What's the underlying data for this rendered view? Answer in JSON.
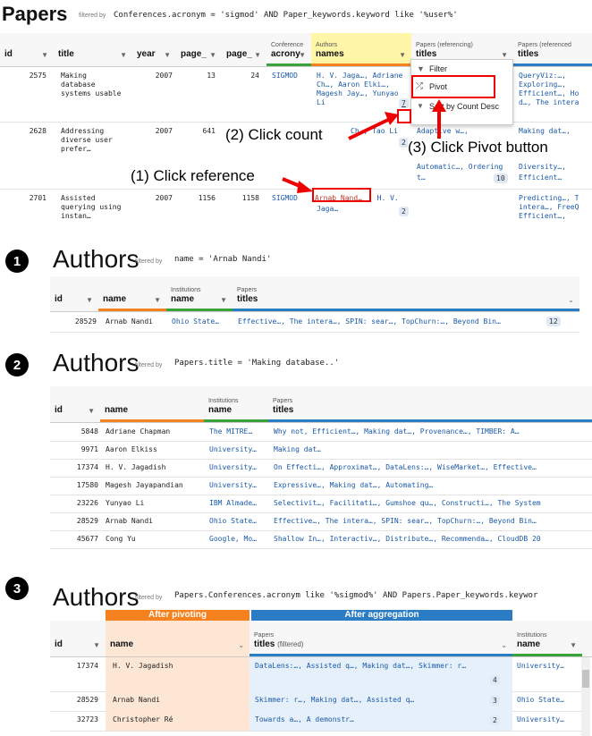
{
  "papers": {
    "title": "Papers",
    "filtered_by": "filtered by",
    "filter": "Conferences.acronym = 'sigmod' AND Paper_keywords.keyword like '%user%'",
    "columns": {
      "id": "id",
      "title": "title",
      "year": "year",
      "page1": "page_",
      "page2": "page_",
      "conf_sub": "Conference",
      "conf_main": "acrony",
      "authors_sub": "Authors",
      "authors_main": "names",
      "pref_sub": "Papers (referencing)",
      "pref_main": "titles",
      "pref2_sub": "Papers (referenced",
      "pref2_main": "titles"
    },
    "rows": [
      {
        "id": "2575",
        "title": [
          "Making",
          "database",
          "systems usable"
        ],
        "year": "2007",
        "p1": "13",
        "p2": "24",
        "conf": "SIGMOD",
        "authors": [
          "H. V. Jaga…, Adriane",
          "Ch…, Aaron Elki…,",
          "Magesh Jay…, Yunyao",
          "Li"
        ],
        "authors_count": "7",
        "ref2": [
          "QueryViz:…,",
          "Exploring…,",
          "Efficient…, Ho",
          "d…, The intera"
        ]
      },
      {
        "id": "2628",
        "title": [
          "Addressing",
          "diverse user",
          "prefer…"
        ],
        "year": "2007",
        "p1": "641",
        "p2": "",
        "conf": "",
        "authors": [
          "Ch…, Tao Li"
        ],
        "authors_count": "2",
        "refing": [
          "Adaptive w…,",
          "",
          "Automatic…, Ordering",
          "t…"
        ],
        "refing_count": "10",
        "ref2": [
          "Making dat…,",
          "",
          "Diversity…,",
          "Efficient…"
        ]
      },
      {
        "id": "2701",
        "title": [
          "Assisted",
          "querying using",
          "instan…"
        ],
        "year": "2007",
        "p1": "1156",
        "p2": "1158",
        "conf": "SIGMOD",
        "authors_link": "Arnab Nand…",
        "authors_rest": ", H. V.",
        "authors2": "Jaga…",
        "authors_count": "2",
        "ref2": [
          "Predicting…, T",
          "intera…, FreeQ",
          "Efficient…,"
        ]
      }
    ],
    "menu": {
      "filter": "Filter",
      "pivot": "Pivot",
      "sort": "Sort by Count Desc"
    }
  },
  "annotations": {
    "click_count": "(2) Click count",
    "click_pivot": "(3) Click Pivot button",
    "click_reference": "(1) Click reference"
  },
  "step1": {
    "badge": "1",
    "title": "Authors",
    "filtered_by": "filtered by",
    "filter": "name = 'Arnab Nandi'",
    "columns": {
      "id": "id",
      "name": "name",
      "inst_sub": "Institutions",
      "inst_main": "name",
      "papers_sub": "Papers",
      "papers_main": "titles"
    },
    "rows": [
      {
        "id": "28529",
        "name": "Arnab Nandi",
        "inst": "Ohio State…",
        "papers": "Effective…, The intera…, SPIN: sear…, TopChurn:…, Beyond Bin…",
        "count": "12"
      }
    ]
  },
  "step2": {
    "badge": "2",
    "title": "Authors",
    "filtered_by": "filtered by",
    "filter": "Papers.title = 'Making database..'",
    "columns": {
      "id": "id",
      "name": "name",
      "inst_sub": "Institutions",
      "inst_main": "name",
      "papers_sub": "Papers",
      "papers_main": "titles"
    },
    "rows": [
      {
        "id": "5848",
        "name": "Adriane Chapman",
        "inst": "The MITRE…",
        "papers": "Why not, Efficient…, Making dat…, Provenance…, TIMBER: A…"
      },
      {
        "id": "9971",
        "name": "Aaron Elkiss",
        "inst": "University…",
        "papers": "Making dat…"
      },
      {
        "id": "17374",
        "name": "H. V. Jagadish",
        "inst": "University…",
        "papers": "On Effecti…, Approximat…, DataLens:…, WiseMarket…, Effective…"
      },
      {
        "id": "17580",
        "name": "Magesh Jayapandian",
        "inst": "University…",
        "papers": "Expressive…, Making dat…, Automating…"
      },
      {
        "id": "23226",
        "name": "Yunyao Li",
        "inst": "IBM Almade…",
        "papers": "Selectivit…, Facilitati…, Gumshoe qu…, Constructi…, The System"
      },
      {
        "id": "28529",
        "name": "Arnab Nandi",
        "inst": "Ohio State…",
        "papers": "Effective…, The intera…, SPIN: sear…, TopChurn:…, Beyond Bin…"
      },
      {
        "id": "45677",
        "name": "Cong Yu",
        "inst": "Google, Mo…",
        "papers": "Shallow In…, Interactiv…, Distribute…, Recommenda…, CloudDB 20"
      }
    ]
  },
  "step3": {
    "badge": "3",
    "title": "Authors",
    "filtered_by": "filtered by",
    "filter": "Papers.Conferences.acronym like '%sigmod%' AND Papers.Paper_keywords.keywor",
    "after_pivoting": "After pivoting",
    "after_aggregation": "After aggregation",
    "columns": {
      "id": "id",
      "name": "name",
      "papers_sub": "Papers",
      "papers_main": "titles",
      "papers_note": "(filtered)",
      "inst_sub": "Institutions",
      "inst_main": "name"
    },
    "rows": [
      {
        "id": "17374",
        "name": "H. V. Jagadish",
        "papers": "DataLens:…, Assisted q…, Making dat…, Skimmer: r…",
        "count": "4",
        "inst": "University…"
      },
      {
        "id": "28529",
        "name": "Arnab Nandi",
        "papers": "Skimmer: r…, Making dat…, Assisted q…",
        "count": "3",
        "inst": "Ohio State…"
      },
      {
        "id": "32723",
        "name": "Christopher Ré",
        "papers": "Towards a…, A demonstr…",
        "count": "2",
        "inst": "University…"
      }
    ]
  },
  "colors": {
    "orange": "#f5821f",
    "green": "#3aa23a",
    "yellow": "#fff6a8",
    "blue": "#2a7dc4",
    "red": "#e00000"
  }
}
